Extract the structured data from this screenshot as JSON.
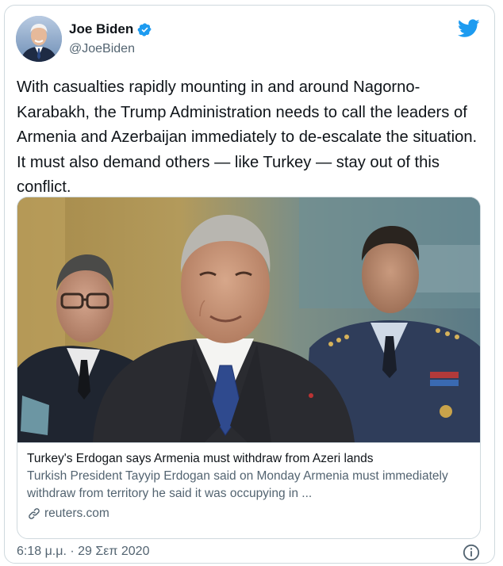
{
  "author": {
    "display_name": "Joe Biden",
    "handle": "@JoeBiden",
    "verified": true,
    "avatar_icon": "portrait-avatar",
    "verified_icon": "verified-badge-icon"
  },
  "brand": {
    "icon": "twitter-bird-icon",
    "color": "#1d9bf0"
  },
  "tweet": {
    "text": "With casualties rapidly mounting in and around Nagorno-Karabakh, the Trump Administration needs to call the leaders of Armenia and Azerbaijan immediately to de-escalate the situation. It must also demand others — like Turkey — stay out of this conflict."
  },
  "link_card": {
    "image_icon": "news-photo",
    "title": "Turkey's Erdogan says Armenia must withdraw from Azeri lands",
    "description": "Turkish President Tayyip Erdogan said on Monday Armenia must immediately withdraw from territory he said it was occupying in ...",
    "domain": "reuters.com",
    "domain_icon": "link-icon"
  },
  "footer": {
    "timestamp": "6:18 μ.μ. · 29 Σεπ 2020",
    "info_icon": "info-icon"
  },
  "colors": {
    "text": "#0f1419",
    "secondary_text": "#536471",
    "border": "#cfd9de"
  }
}
